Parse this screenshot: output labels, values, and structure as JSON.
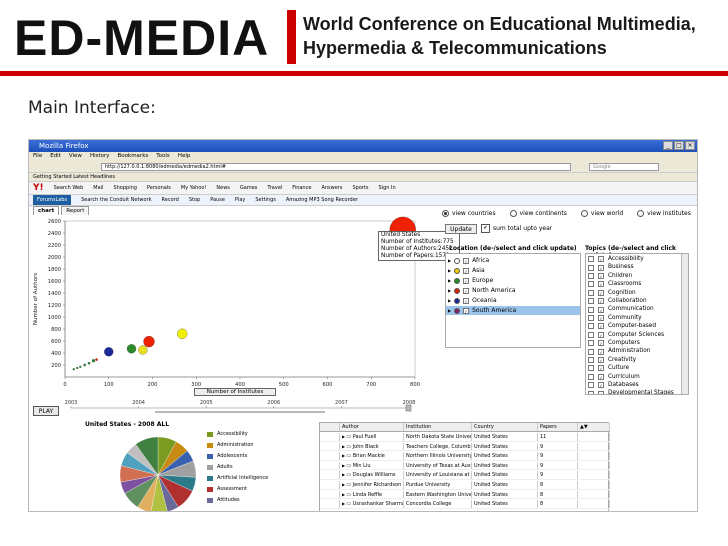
{
  "banner": {
    "logo": "ED-MEDIA",
    "line1": "World Conference on Educational Multimedia,",
    "line2": "Hypermedia & Telecommunications"
  },
  "heading": "Main Interface:",
  "browser": {
    "title": "Mozilla Firefox",
    "menu": [
      "File",
      "Edit",
      "View",
      "History",
      "Bookmarks",
      "Tools",
      "Help"
    ],
    "url": "http://127.0.0.1:8080/edmedia/edmedia2.html#",
    "search_placeholder": "Google",
    "bookmarks": "Getting Started   Latest Headlines",
    "yahoo_logo": "Y!",
    "yahoo_items": [
      "Search Web",
      "Mail",
      "Shopping",
      "Personals",
      "My Yahoo!",
      "News",
      "Games",
      "Travel",
      "Finance",
      "Answers",
      "Sports",
      "Sign In"
    ],
    "conduit_box": "ForumsLabs",
    "conduit_items": [
      "Search the Conduit Network",
      "Record",
      "Stop",
      "Pause",
      "Play",
      "Settings",
      "Amazing MP3 Song Recorder"
    ]
  },
  "tabs": [
    "chart",
    "Report"
  ],
  "chart_data": {
    "type": "scatter",
    "xlabel": "Number of Institutes",
    "ylabel": "Number of Authors",
    "xlim": [
      0,
      800
    ],
    "ylim": [
      0,
      2600
    ],
    "xticks": [
      0,
      100,
      200,
      300,
      400,
      500,
      600,
      700,
      800
    ],
    "yticks": [
      200,
      400,
      600,
      800,
      1000,
      1200,
      1400,
      1600,
      1800,
      2000,
      2200,
      2400,
      2600
    ],
    "points": [
      {
        "x": 772,
        "y": 2452,
        "color": "#ee2200",
        "r": 13
      },
      {
        "x": 100,
        "y": 420,
        "color": "#1a2a9a",
        "r": 4.5
      },
      {
        "x": 152,
        "y": 470,
        "color": "#2a8a2a",
        "r": 4.5
      },
      {
        "x": 178,
        "y": 450,
        "color": "#e8e020",
        "r": 4.5
      },
      {
        "x": 192,
        "y": 590,
        "color": "#ee2200",
        "r": 5.5
      },
      {
        "x": 268,
        "y": 720,
        "color": "#f0f000",
        "r": 5
      },
      {
        "x": 65,
        "y": 270,
        "color": "#2a8a2a",
        "r": 1.5
      },
      {
        "x": 55,
        "y": 230,
        "color": "#2a8a2a",
        "r": 1.2
      },
      {
        "x": 45,
        "y": 200,
        "color": "#2a8a2a",
        "r": 1.2
      },
      {
        "x": 35,
        "y": 170,
        "color": "#2a8a2a",
        "r": 1
      },
      {
        "x": 28,
        "y": 150,
        "color": "#2a8a2a",
        "r": 1
      },
      {
        "x": 20,
        "y": 130,
        "color": "#2a8a2a",
        "r": 1
      },
      {
        "x": 72,
        "y": 290,
        "color": "#ee2200",
        "r": 1.2
      }
    ]
  },
  "tooltip": {
    "line1": "United States",
    "line2": "Number of Institutes:775",
    "line3": "Number of Authors:2452",
    "line4": "Number of Papers:1571"
  },
  "play_label": "PLAY",
  "timeline_years": [
    "2003",
    "2004",
    "2005",
    "2006",
    "2007",
    "2008"
  ],
  "view_options": [
    {
      "label": "view countries",
      "on": true
    },
    {
      "label": "view continents",
      "on": false
    },
    {
      "label": "view world",
      "on": false
    },
    {
      "label": "view institutes",
      "on": false
    }
  ],
  "update_label": "Update",
  "sum_label": "sum total upto year",
  "location_label": "Location (de-/select and click update)",
  "topics_label": "Topics (de-/select and click update)",
  "locations": [
    {
      "name": "Africa",
      "color": "#ffffff",
      "sel": false
    },
    {
      "name": "Asia",
      "color": "#f0d000",
      "sel": false
    },
    {
      "name": "Europe",
      "color": "#2a8a2a",
      "sel": false
    },
    {
      "name": "North America",
      "color": "#dd2200",
      "sel": false
    },
    {
      "name": "Oceania",
      "color": "#1a2a9a",
      "sel": false
    },
    {
      "name": "South America",
      "color": "#882266",
      "sel": true
    }
  ],
  "topics": [
    "Accessibility",
    "Business",
    "Children",
    "Classrooms",
    "Cognition",
    "Collaboration",
    "Communication",
    "Community",
    "Computer-based",
    "Computer Sciences",
    "Computers",
    "Administration",
    "Creativity",
    "Culture",
    "Curriculum",
    "Databases",
    "Developmental Stages"
  ],
  "pie_title": "United States - 2008 ALL",
  "pie_slices": [
    {
      "label": "Accessibility",
      "value": 8,
      "color": "#7a9a20"
    },
    {
      "label": "Administration",
      "value": 6,
      "color": "#c88a10"
    },
    {
      "label": "Adolescents",
      "value": 5,
      "color": "#3a60b0"
    },
    {
      "label": "Adults",
      "value": 7,
      "color": "#a0a0a0"
    },
    {
      "label": "Artificial Intelligence",
      "value": 6,
      "color": "#2a7a8a"
    },
    {
      "label": "Assessment",
      "value": 9,
      "color": "#b03030"
    },
    {
      "label": "Attitudes",
      "value": 5,
      "color": "#6a6a9a"
    },
    {
      "label": "",
      "value": 7,
      "color": "#b0c040"
    },
    {
      "label": "",
      "value": 6,
      "color": "#e0b060"
    },
    {
      "label": "",
      "value": 8,
      "color": "#609060"
    },
    {
      "label": "",
      "value": 5,
      "color": "#8050a0"
    },
    {
      "label": "",
      "value": 7,
      "color": "#d07050"
    },
    {
      "label": "",
      "value": 6,
      "color": "#50a0c0"
    },
    {
      "label": "",
      "value": 5,
      "color": "#c0c0c0"
    },
    {
      "label": "",
      "value": 10,
      "color": "#408040"
    }
  ],
  "table": {
    "headers": [
      "",
      "Author",
      "Institution",
      "Country",
      "Papers",
      "▲▼"
    ],
    "rows": [
      [
        "",
        "Paul Fuell",
        "North Dakota State University",
        "United States",
        "11",
        ""
      ],
      [
        "",
        "John Black",
        "Teachers College, Columbia",
        "United States",
        "9",
        ""
      ],
      [
        "",
        "Brian Mackie",
        "Northern Illinois University",
        "United States",
        "9",
        ""
      ],
      [
        "",
        "Min Liu",
        "University of Texas at Austin",
        "United States",
        "9",
        ""
      ],
      [
        "",
        "Douglas Williams",
        "University of Louisiana at La",
        "United States",
        "9",
        ""
      ],
      [
        "",
        "Jennifer Richardson",
        "Purdue University",
        "United States",
        "8",
        ""
      ],
      [
        "",
        "Linda Reffle",
        "Eastern Washington Universi",
        "United States",
        "8",
        ""
      ],
      [
        "",
        "Usrashankar Sharma",
        "Concordia College",
        "United States",
        "8",
        ""
      ]
    ]
  }
}
